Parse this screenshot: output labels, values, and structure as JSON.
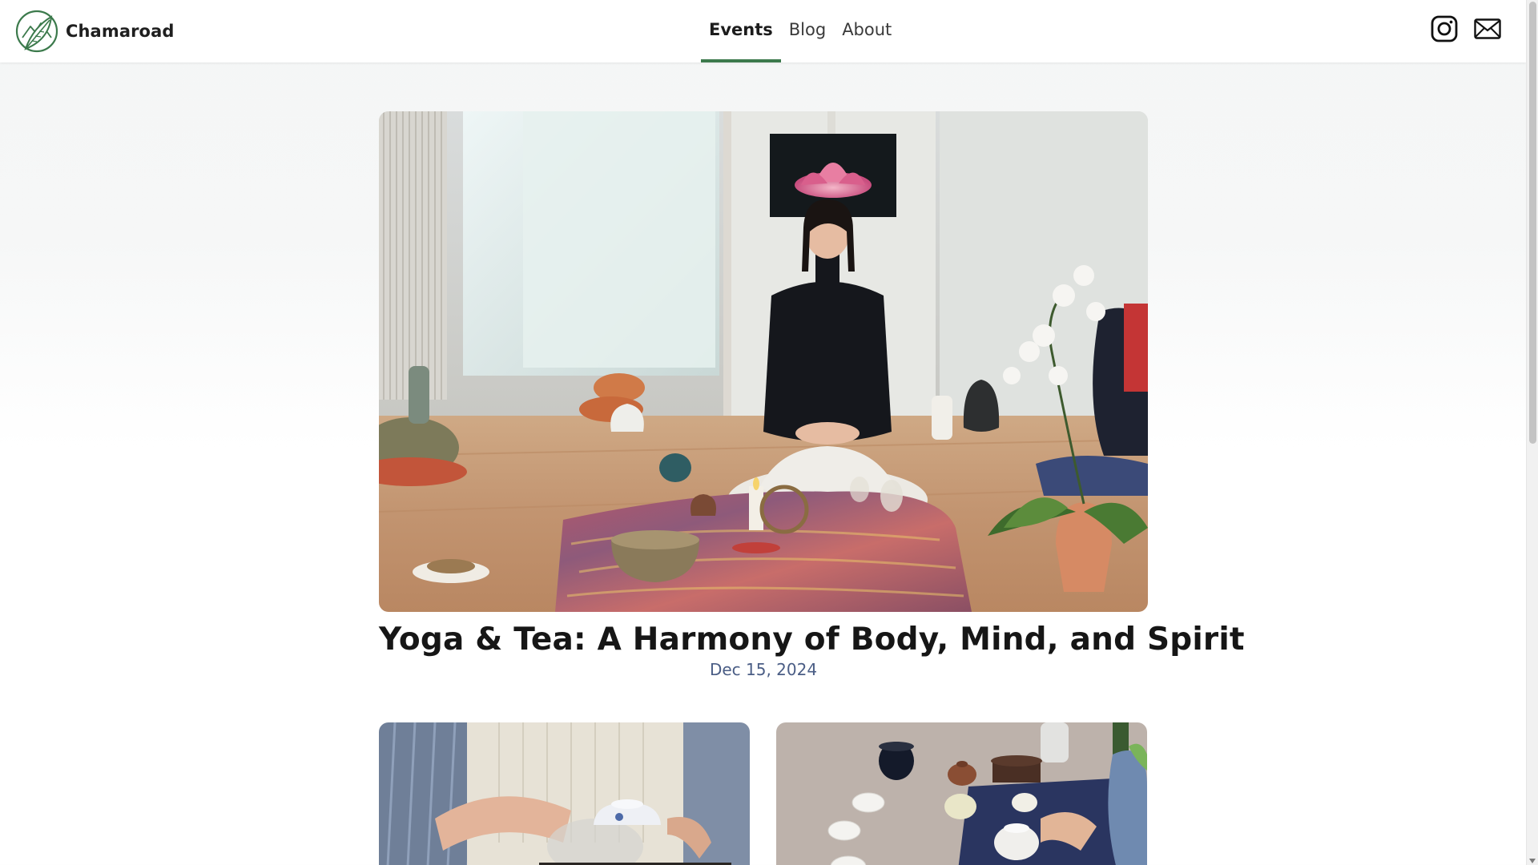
{
  "brand": {
    "name": "Chamaroad",
    "logo_icon": "tea-leaf-mountain-icon",
    "accent_color": "#3c7a4c"
  },
  "nav": {
    "items": [
      {
        "label": "Events",
        "active": true
      },
      {
        "label": "Blog",
        "active": false
      },
      {
        "label": "About",
        "active": false
      }
    ]
  },
  "social": {
    "instagram_icon": "instagram-icon",
    "email_icon": "envelope-icon"
  },
  "featured_event": {
    "title": "Yoga & Tea: A Harmony of Body, Mind, and Spirit",
    "date": "Dec 15, 2024",
    "image": "photo of a woman sitting cross-legged leading a yoga and tea session with candles, tea pots and a lotus painting"
  },
  "event_cards": [
    {
      "image": "photo of hands pouring tea from a porcelain gaiwan"
    },
    {
      "image": "photo of a tea table with small white cups and a teapot"
    }
  ]
}
